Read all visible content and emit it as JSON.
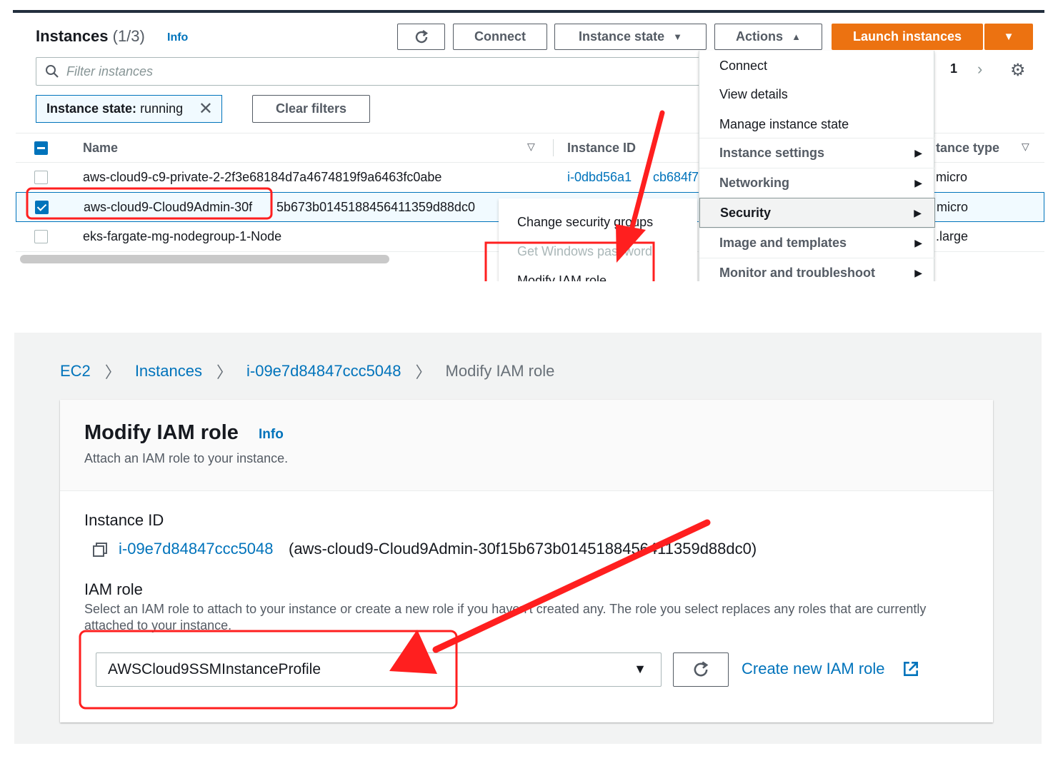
{
  "instances_panel": {
    "title": "Instances",
    "count": "(1/3)",
    "info": "Info",
    "buttons": {
      "refresh_icon": "refresh-icon",
      "connect": "Connect",
      "instance_state": "Instance state",
      "actions": "Actions",
      "launch": "Launch instances"
    },
    "filter_placeholder": "Filter instances",
    "pagination": {
      "page": "1"
    },
    "active_filter": {
      "key": "Instance state:",
      "value": "running"
    },
    "clear_filters": "Clear filters",
    "columns": [
      "Name",
      "Instance ID",
      "tance type"
    ],
    "rows": [
      {
        "name": "aws-cloud9-c9-private-2-2f3e68184d7a4674819f9a6463fc0abe",
        "id": "i-0dbd56a1",
        "id_tail": "cb684f7",
        "type": "micro",
        "selected": false
      },
      {
        "name": "aws-cloud9-Cloud9Admin-30f",
        "name_tail": "5b673b0145188456411359d88dc0",
        "id": "",
        "type": "micro",
        "selected": true
      },
      {
        "name": "eks-fargate-mg-nodegroup-1-Node",
        "id": "",
        "type": ".large",
        "selected": false
      }
    ],
    "actions_menu": [
      {
        "label": "Connect",
        "submenu": false
      },
      {
        "label": "View details",
        "submenu": false
      },
      {
        "label": "Manage instance state",
        "submenu": false
      },
      {
        "label": "Instance settings",
        "submenu": true
      },
      {
        "label": "Networking",
        "submenu": true
      },
      {
        "label": "Security",
        "submenu": true,
        "highlighted": true
      },
      {
        "label": "Image and templates",
        "submenu": true
      },
      {
        "label": "Monitor and troubleshoot",
        "submenu": true
      }
    ],
    "security_submenu": [
      {
        "label": "Change security groups",
        "disabled": false
      },
      {
        "label": "Get Windows password",
        "disabled": true
      },
      {
        "label": "Modify IAM role",
        "disabled": false
      }
    ]
  },
  "modify_panel": {
    "breadcrumbs": [
      "EC2",
      "Instances",
      "i-09e7d84847ccc5048",
      "Modify IAM role"
    ],
    "title": "Modify IAM role",
    "info": "Info",
    "description": "Attach an IAM role to your instance.",
    "instance_id_label": "Instance ID",
    "instance_id": "i-09e7d84847ccc5048",
    "instance_name": "(aws-cloud9-Cloud9Admin-30f15b673b0145188456411359d88dc0)",
    "iam_role_label": "IAM role",
    "iam_role_help": "Select an IAM role to attach to your instance or create a new role if you haven't created any. The role you select replaces any roles that are currently attached to your instance.",
    "selected_role": "AWSCloud9SSMInstanceProfile",
    "create_role_link": "Create new IAM role"
  },
  "colors": {
    "link": "#0073bb",
    "primary_button": "#ec7211",
    "annotation": "#ff1f1f",
    "header_bar": "#232f3e"
  }
}
